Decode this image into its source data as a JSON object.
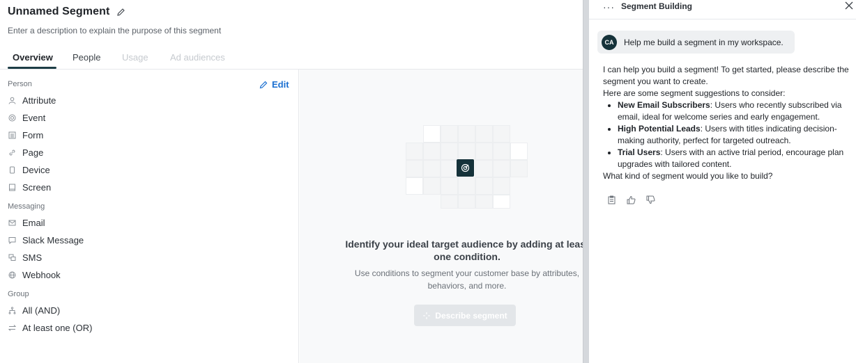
{
  "segment": {
    "title": "Unnamed Segment",
    "description_placeholder": "Enter a description to explain the purpose of this segment"
  },
  "tabs": [
    {
      "label": "Overview"
    },
    {
      "label": "People"
    },
    {
      "label": "Usage"
    },
    {
      "label": "Ad audiences"
    }
  ],
  "sidebar": {
    "edit_label": "Edit",
    "sections": {
      "person": "Person",
      "messaging": "Messaging",
      "group": "Group"
    },
    "person_items": [
      {
        "label": "Attribute",
        "icon": "person-icon"
      },
      {
        "label": "Event",
        "icon": "event-icon"
      },
      {
        "label": "Form",
        "icon": "form-icon"
      },
      {
        "label": "Page",
        "icon": "link-icon"
      },
      {
        "label": "Device",
        "icon": "device-icon"
      },
      {
        "label": "Screen",
        "icon": "screen-icon"
      }
    ],
    "messaging_items": [
      {
        "label": "Email",
        "icon": "email-icon"
      },
      {
        "label": "Slack Message",
        "icon": "slack-message-icon"
      },
      {
        "label": "SMS",
        "icon": "sms-icon"
      },
      {
        "label": "Webhook",
        "icon": "webhook-icon"
      }
    ],
    "group_items": [
      {
        "label": "All (AND)",
        "icon": "and-icon"
      },
      {
        "label": "At least one (OR)",
        "icon": "or-icon"
      }
    ]
  },
  "empty_state": {
    "title": "Identify your ideal target audience by adding at least one condition.",
    "subtitle": "Use conditions to segment your customer base by attributes, behaviors, and more.",
    "button_label": "Describe segment"
  },
  "assistant": {
    "menu_label": "···",
    "title": "Segment Building",
    "user_initials": "CA",
    "user_message": "Help me build a segment in my workspace.",
    "reply_intro": "I can help you build a segment! To get started, please describe the segment you want to create.",
    "reply_lead": "Here are some segment suggestions to consider:",
    "suggestions": [
      {
        "name": "New Email Subscribers",
        "text": ": Users who recently subscribed via email, ideal for welcome series and early engagement."
      },
      {
        "name": "High Potential Leads",
        "text": ": Users with titles indicating decision-making authority, perfect for targeted outreach."
      },
      {
        "name": "Trial Users",
        "text": ": Users with an active trial period, encourage plan upgrades with tailored content."
      }
    ],
    "reply_question": "What kind of segment would you like to build?"
  },
  "colors": {
    "accent": "#1a6fd1",
    "brand_dark": "#15323a",
    "tab_underline": "#1d3d46"
  }
}
